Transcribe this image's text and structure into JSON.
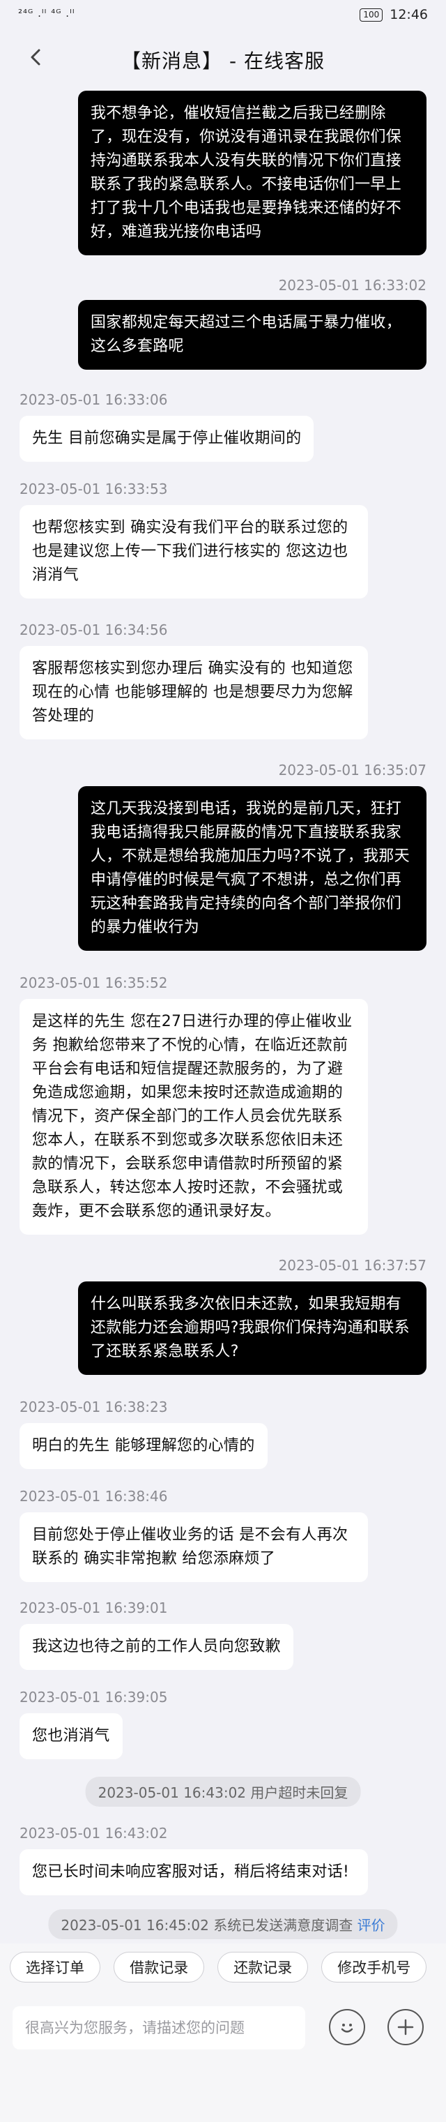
{
  "status_bar": {
    "signal": "²⁴ᴳ .ᴵᴵ ⁴ᴳ .ᴵᴵ",
    "battery": "100",
    "time": "12:46"
  },
  "header": {
    "title": "【新消息】 - 在线客服"
  },
  "messages": [
    {
      "role": "user",
      "time": "",
      "text": "我不想争论，催收短信拦截之后我已经删除了，现在没有，你说没有通讯录在我跟你们保持沟通联系我本人没有失联的情况下你们直接联系了我的紧急联系人。不接电话你们一早上打了我十几个电话我也是要挣钱来还储的好不好，难道我光接你电话吗"
    },
    {
      "role": "user",
      "time": "2023-05-01 16:33:02",
      "text": "国家都规定每天超过三个电话属于暴力催收，这么多套路呢"
    },
    {
      "role": "agent",
      "time": "2023-05-01 16:33:06",
      "text": "先生 目前您确实是属于停止催收期间的"
    },
    {
      "role": "agent",
      "time": "2023-05-01 16:33:53",
      "text": "也帮您核实到 确实没有我们平台的联系过您的 也是建议您上传一下我们进行核实的  您这边也消消气"
    },
    {
      "role": "agent",
      "time": "2023-05-01 16:34:56",
      "text": "客服帮您核实到您办理后 确实没有的 也知道您现在的心情 也能够理解的 也是想要尽力为您解答处理的"
    },
    {
      "role": "user",
      "time": "2023-05-01 16:35:07",
      "text": "这几天我没接到电话，我说的是前几天，狂打我电话搞得我只能屏蔽的情况下直接联系我家人，不就是想给我施加压力吗?不说了，我那天申请停催的时候是气疯了不想讲，总之你们再玩这种套路我肯定持续的向各个部门举报你们的暴力催收行为"
    },
    {
      "role": "agent",
      "time": "2023-05-01 16:35:52",
      "text": "是这样的先生 您在27日进行办理的停止催收业务  抱歉给您带来了不悅的心情，在临近还款前平台会有电话和短信提醒还款服务的，为了避免造成您逾期，如果您未按时还款造成逾期的情况下，资产保全部门的工作人员会优先联系您本人，在联系不到您或多次联系您依旧未还款的情况下，会联系您申请借款时所预留的紧急联系人，转达您本人按时还款，不会骚扰或轰炸，更不会联系您的通讯录好友。"
    },
    {
      "role": "user",
      "time": "2023-05-01 16:37:57",
      "text": "什么叫联系我多次依旧未还款，如果我短期有还款能力还会逾期吗?我跟你们保持沟通和联系了还联系紧急联系人?"
    },
    {
      "role": "agent",
      "time": "2023-05-01 16:38:23",
      "text": "明白的先生 能够理解您的心情的"
    },
    {
      "role": "agent",
      "time": "2023-05-01 16:38:46",
      "text": "目前您处于停止催收业务的话 是不会有人再次联系的 确实非常抱歉 给您添麻烦了"
    },
    {
      "role": "agent",
      "time": "2023-05-01 16:39:01",
      "text": "我这边也待之前的工作人员向您致歉"
    },
    {
      "role": "agent",
      "time": "2023-05-01 16:39:05",
      "text": "您也消消气"
    },
    {
      "role": "system",
      "text": "2023-05-01 16:43:02 用户超时未回复"
    },
    {
      "role": "agent",
      "time": "2023-05-01 16:43:02",
      "text": "您已长时间未响应客服对话，稍后将结束对话!"
    },
    {
      "role": "system",
      "text": "2023-05-01 16:45:02 系统已发送满意度调查",
      "link": "评价"
    }
  ],
  "quick_actions": [
    "选择订单",
    "借款记录",
    "还款记录",
    "修改手机号"
  ],
  "input": {
    "placeholder": "很高兴为您服务，请描述您的问题",
    "value": ""
  }
}
